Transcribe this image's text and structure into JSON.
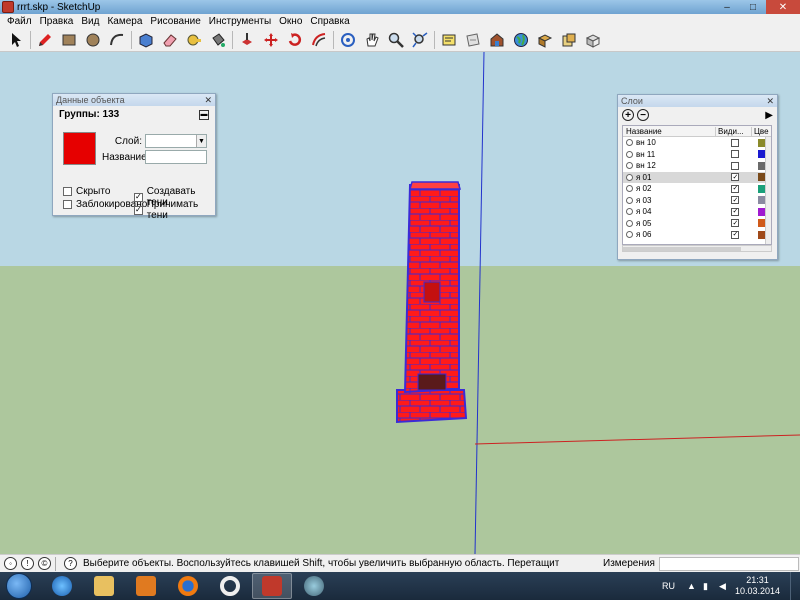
{
  "window": {
    "title": "rrrt.skp - SketchUp",
    "controls": [
      "–",
      "□",
      "✕"
    ]
  },
  "menu": [
    "Файл",
    "Правка",
    "Вид",
    "Камера",
    "Рисование",
    "Инструменты",
    "Окно",
    "Справка"
  ],
  "toolbar": {
    "tools": [
      "select-tool",
      "pencil-tool",
      "rectangle-tool",
      "circle-tool",
      "arc-tool",
      "make-component-tool",
      "eraser-tool",
      "tape-measure-tool",
      "paint-bucket-tool",
      "push-pull-tool",
      "move-tool",
      "rotate-tool",
      "offset-tool",
      "orbit-tool",
      "pan-tool",
      "zoom-tool",
      "zoom-extents-tool",
      "section-tool",
      "previous-view-tool",
      "warehouse-tool",
      "globe-tool",
      "components-tool",
      "materials-tool",
      "styles-tool"
    ]
  },
  "entity_info": {
    "title": "Данные объекта",
    "header": "Группы: 133",
    "color": "#e60000",
    "layer_label": "Слой:",
    "layer_value": "",
    "name_label": "Название:",
    "name_value": "",
    "hidden_label": "Скрыто",
    "hidden_checked": false,
    "locked_label": "Заблокировано",
    "locked_checked": false,
    "cast_shadows_label": "Создавать тени",
    "cast_shadows_checked": true,
    "receive_shadows_label": "Принимать тени",
    "receive_shadows_checked": true
  },
  "layers": {
    "title": "Слои",
    "col_name": "Название",
    "col_visible": "Види...",
    "col_color": "Цве",
    "rows": [
      {
        "name": "вн 10",
        "visible": false,
        "color": "#8a8a2a",
        "selected": false
      },
      {
        "name": "вн 11",
        "visible": false,
        "color": "#1a1ad0",
        "selected": false
      },
      {
        "name": "вн 12",
        "visible": false,
        "color": "#6a6a6a",
        "selected": false
      },
      {
        "name": "я 01",
        "visible": true,
        "color": "#7a4a1a",
        "selected": true
      },
      {
        "name": "я 02",
        "visible": true,
        "color": "#1aa07a",
        "selected": false
      },
      {
        "name": "я 03",
        "visible": true,
        "color": "#8a8aa0",
        "selected": false
      },
      {
        "name": "я 04",
        "visible": true,
        "color": "#a01ad0",
        "selected": false
      },
      {
        "name": "я 05",
        "visible": true,
        "color": "#d05a1a",
        "selected": false
      },
      {
        "name": "я 06",
        "visible": true,
        "color": "#a04a1a",
        "selected": false
      }
    ]
  },
  "status": {
    "message": "Выберите объекты. Воспользуйтесь клавишей Shift, чтобы увеличить выбранную область. Перетащите мышь, ч",
    "measurements_label": "Измерения",
    "measurements_value": ""
  },
  "taskbar": {
    "apps": [
      "windows-explorer",
      "file-manager",
      "media-player",
      "firefox",
      "opera",
      "sketchup",
      "tool-app"
    ],
    "language": "RU",
    "time": "21:31",
    "date": "10.03.2014"
  },
  "scene": {
    "sky_color": "#b9d7e4",
    "ground_color": "#adc79d",
    "object_fill": "#ff1a1a",
    "object_edge": "#3b2bd6"
  }
}
